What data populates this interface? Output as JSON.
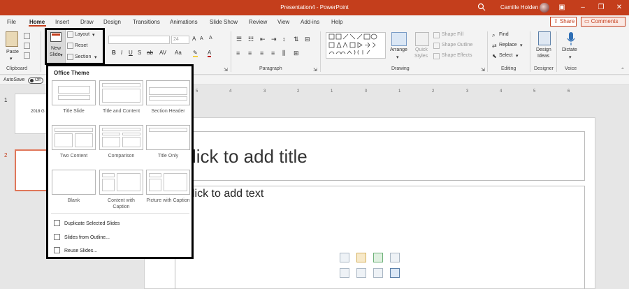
{
  "window": {
    "title": "Presentation4 - PowerPoint",
    "user": "Camille Holden",
    "accent": "#c43e1c"
  },
  "tabs": [
    "File",
    "Home",
    "Insert",
    "Draw",
    "Design",
    "Transitions",
    "Animations",
    "Slide Show",
    "Review",
    "View",
    "Add-ins",
    "Help"
  ],
  "header_buttons": {
    "share": "Share",
    "comments": "Comments"
  },
  "ribbon": {
    "clipboard": {
      "paste": "Paste",
      "group": "Clipboard"
    },
    "slides": {
      "new_slide_line1": "New",
      "new_slide_line2": "Slide",
      "layout": "Layout",
      "reset": "Reset",
      "section": "Section"
    },
    "font": {
      "size": "24"
    },
    "paragraph": {
      "group": "Paragraph"
    },
    "drawing": {
      "arrange": "Arrange",
      "quick_styles_1": "Quick",
      "quick_styles_2": "Styles",
      "shape_fill": "Shape Fill",
      "shape_outline": "Shape Outline",
      "shape_effects": "Shape Effects",
      "group": "Drawing"
    },
    "editing": {
      "find": "Find",
      "replace": "Replace",
      "select": "Select",
      "group": "Editing"
    },
    "designer": {
      "design_ideas_1": "Design",
      "design_ideas_2": "Ideas",
      "group": "Designer"
    },
    "voice": {
      "dictate": "Dictate",
      "group": "Voice"
    }
  },
  "autosave": {
    "label": "AutoSave",
    "state": "Off"
  },
  "slide_panel": {
    "slides": [
      {
        "number": "1",
        "text": "2018 G"
      },
      {
        "number": "2",
        "text": ""
      }
    ]
  },
  "editor": {
    "title_placeholder": "lick to add title",
    "text_placeholder": "lick to add text",
    "ruler_marks": [
      "5",
      "4",
      "3",
      "2",
      "1",
      "0",
      "1",
      "2",
      "3",
      "4",
      "5",
      "6"
    ]
  },
  "dropdown": {
    "header": "Office Theme",
    "layouts": [
      {
        "name": "Title Slide"
      },
      {
        "name": "Title and Content"
      },
      {
        "name": "Section Header"
      },
      {
        "name": "Two Content"
      },
      {
        "name": "Comparison"
      },
      {
        "name": "Title Only"
      },
      {
        "name": "Blank"
      },
      {
        "name": "Content with Caption"
      },
      {
        "name": "Picture with Caption"
      }
    ],
    "actions": [
      "Duplicate Selected Slides",
      "Slides from Outline...",
      "Reuse Slides..."
    ]
  }
}
